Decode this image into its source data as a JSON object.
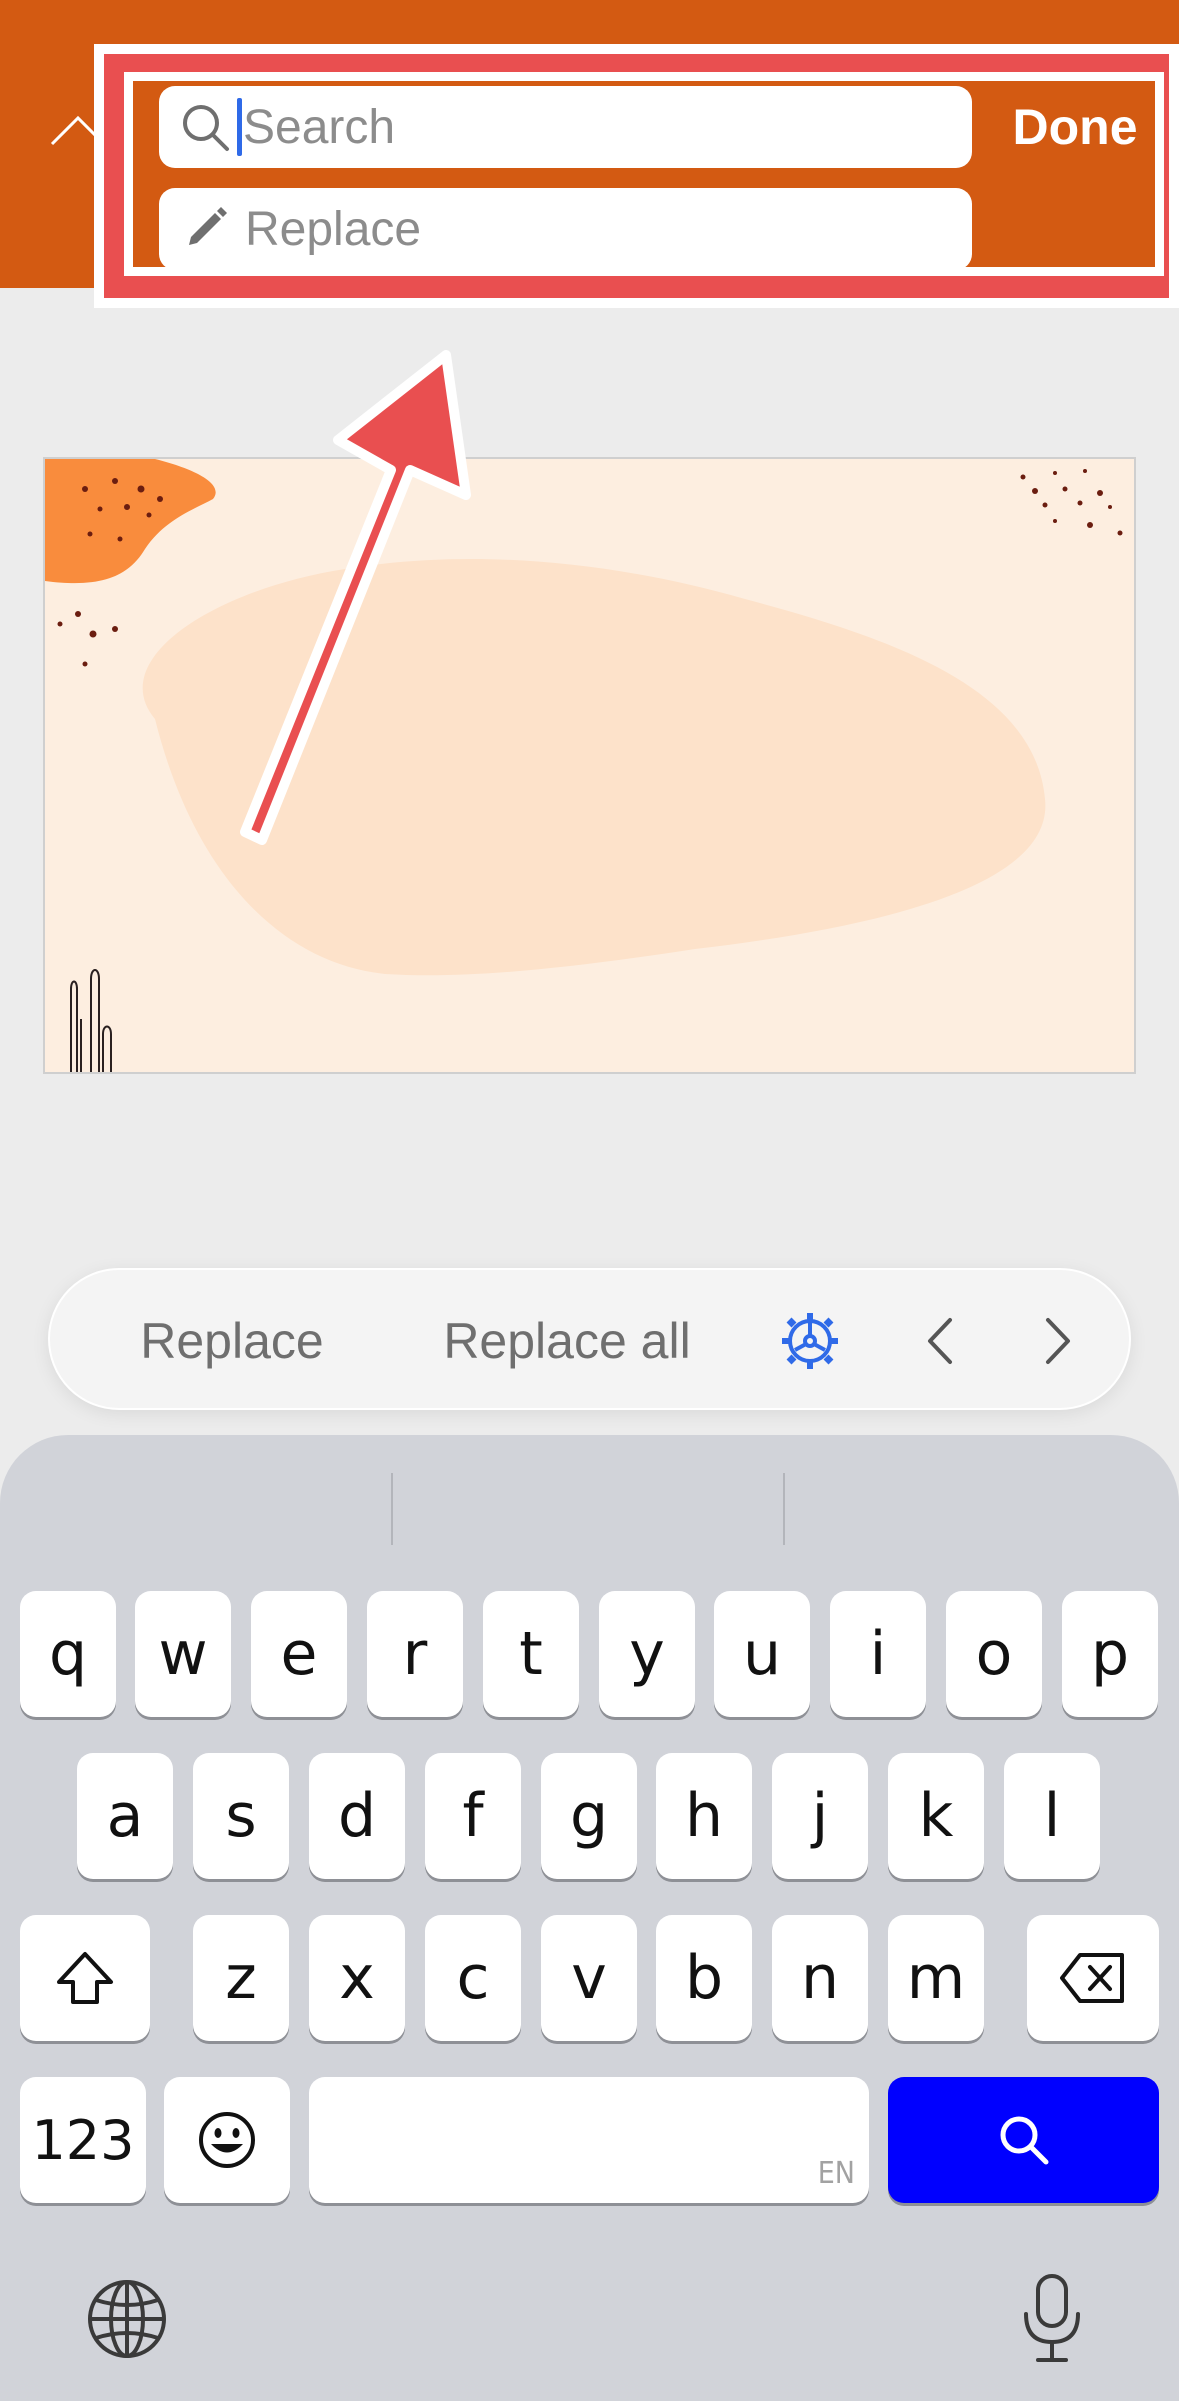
{
  "header": {
    "search_placeholder": "Search",
    "replace_placeholder": "Replace",
    "done_label": "Done"
  },
  "find_toolbar": {
    "replace_label": "Replace",
    "replace_all_label": "Replace all"
  },
  "keyboard": {
    "row1": [
      "q",
      "w",
      "e",
      "r",
      "t",
      "y",
      "u",
      "i",
      "o",
      "p"
    ],
    "row2": [
      "a",
      "s",
      "d",
      "f",
      "g",
      "h",
      "j",
      "k",
      "l"
    ],
    "row3": [
      "z",
      "x",
      "c",
      "v",
      "b",
      "n",
      "m"
    ],
    "numbers_label": "123",
    "space_lang": "EN"
  },
  "colors": {
    "header_orange": "#d35a12",
    "annotation_red": "#e94f50",
    "search_key_blue": "#0000ff",
    "gear_blue": "#2f6ae8"
  },
  "icons": {
    "collapse": "chevron-up-icon",
    "search": "magnifier-icon",
    "replace": "pencil-icon",
    "options": "gear-icon",
    "previous": "chevron-left-icon",
    "next": "chevron-right-icon",
    "shift": "shift-arrow-icon",
    "delete": "backspace-icon",
    "emoji": "smiley-icon",
    "globe": "globe-icon",
    "dictation": "microphone-icon"
  }
}
